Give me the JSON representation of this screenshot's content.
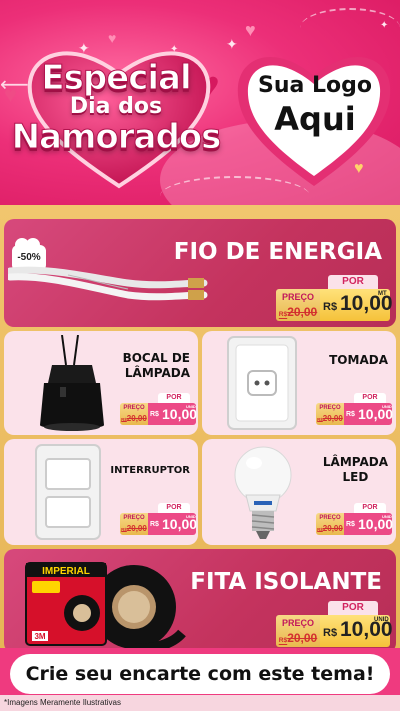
{
  "header": {
    "title_line1": "Especial",
    "title_line2": "Dia dos",
    "title_line3": "Namorados",
    "logo_line1": "Sua Logo",
    "logo_line2": "Aqui"
  },
  "products": [
    {
      "name": "FIO DE ENERGIA",
      "discount": "-50%",
      "por": "POR",
      "preco_label": "PREÇO",
      "old_currency": "R$",
      "old_price": "20,00",
      "currency": "R$",
      "price": "10,00",
      "unit": "MT"
    },
    {
      "name_line1": "BOCAL DE",
      "name_line2": "LÂMPADA",
      "por": "POR",
      "preco_label": "PREÇO",
      "old_currency": "R$",
      "old_price": "20,00",
      "currency": "R$",
      "price": "10,00",
      "unit": "UNID"
    },
    {
      "name": "TOMADA",
      "por": "POR",
      "preco_label": "PREÇO",
      "old_currency": "R$",
      "old_price": "20,00",
      "currency": "R$",
      "price": "10,00",
      "unit": "UNID"
    },
    {
      "name": "INTERRUPTOR",
      "por": "POR",
      "preco_label": "PREÇO",
      "old_currency": "R$",
      "old_price": "20,00",
      "currency": "R$",
      "price": "10,00",
      "unit": "UNID"
    },
    {
      "name_line1": "LÂMPADA",
      "name_line2": "LED",
      "por": "POR",
      "preco_label": "PREÇO",
      "old_currency": "R$",
      "old_price": "20,00",
      "currency": "R$",
      "price": "10,00",
      "unit": "UNID"
    },
    {
      "name": "FITA ISOLANTE",
      "por": "POR",
      "preco_label": "PREÇO",
      "old_currency": "R$",
      "old_price": "20,00",
      "currency": "R$",
      "price": "10,00",
      "unit": "UNID",
      "package_brand": "IMPERIAL",
      "package_mark": "3M"
    }
  ],
  "cta": {
    "label": "Crie seu encarte com este tema!"
  },
  "footnote": "*Imagens Meramente Ilustrativas",
  "colors": {
    "pink": "#ec2f78",
    "gold": "#f1c66e",
    "card_pink": "#c4335e",
    "light_pink": "#fbe2ea"
  }
}
